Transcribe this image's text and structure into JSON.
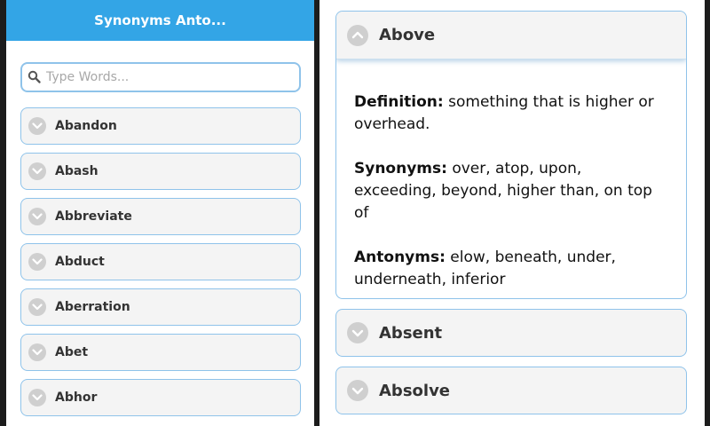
{
  "app": {
    "title": "Synonyms Anto..."
  },
  "search": {
    "placeholder": "Type Words..."
  },
  "word_list": [
    {
      "label": "Abandon"
    },
    {
      "label": "Abash"
    },
    {
      "label": "Abbreviate"
    },
    {
      "label": "Abduct"
    },
    {
      "label": "Aberration"
    },
    {
      "label": "Abet"
    },
    {
      "label": "Abhor"
    }
  ],
  "detail": {
    "expanded": {
      "word": "Above",
      "definition_label": "Definition:",
      "definition": "something that is higher or overhead.",
      "synonyms_label": "Synonyms:",
      "synonyms": "over, atop, upon, exceeding, beyond, higher than, on top of",
      "antonyms_label": "Antonyms:",
      "antonyms": "elow, beneath, under, underneath, inferior"
    },
    "collapsed": [
      {
        "word": "Absent"
      },
      {
        "word": "Absolve"
      }
    ]
  },
  "colors": {
    "header_blue": "#33a5e6",
    "border_blue": "#8fc3ea",
    "item_background": "#f4f4f4",
    "chevron_gray": "#cfcfcf"
  },
  "icons": {
    "search": "search-icon",
    "collapsed": "chevron-down-icon",
    "expanded": "chevron-up-icon"
  }
}
